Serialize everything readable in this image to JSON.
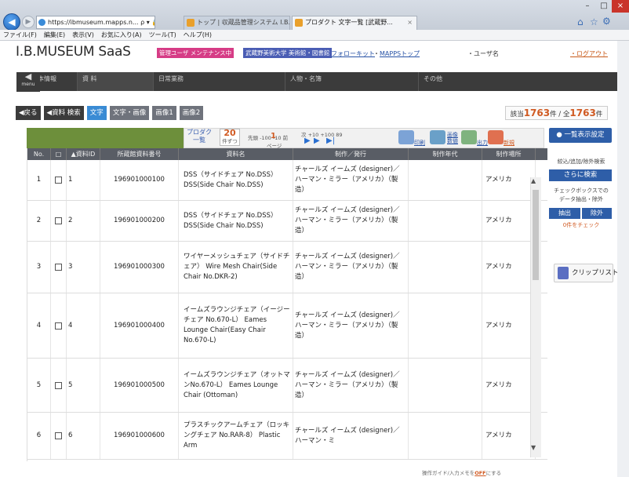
{
  "browser": {
    "address": "https://ibmuseum.mapps.n...",
    "address_icons": "ρ ▾ 🔒 C",
    "tabs": [
      {
        "label": "トップ | 収蔵品管理システム I.B...."
      },
      {
        "label": "プロダクト 文字一覧 [武蔵野...",
        "close": "×"
      }
    ],
    "window_controls": {
      "minimize": "–",
      "maximize": "□",
      "close": "×"
    },
    "toolbar_icons": {
      "home": "⌂",
      "favorites": "☆",
      "settings": "⚙"
    }
  },
  "menubar": [
    "ファイル(F)",
    "編集(E)",
    "表示(V)",
    "お気に入り(A)",
    "ツール(T)",
    "ヘルプ(H)"
  ],
  "header": {
    "logo": "I.B.MUSEUM SaaS",
    "admin_badge": "管理ユーザ メンテナンス中",
    "univ_badge": "武蔵野美術大学 美術館・図書館",
    "follow_link": "フォローキット",
    "mapps_link": "MAPPSトップ",
    "separator": "・",
    "username": "・ユーザ名",
    "logout": "・ログアウト"
  },
  "nav": {
    "menu": "menu",
    "items": [
      "基本情報",
      "資 料",
      "日常業務",
      "人物・名簿",
      "その他"
    ]
  },
  "subtabs": {
    "back": "◀戻る",
    "search": "◀資料 検索",
    "text": "文字",
    "text_image": "文字・画像",
    "image1": "画像1",
    "image2": "画像2"
  },
  "count": {
    "prefix": "該当",
    "hits": "1763",
    "mid": "件 / 全",
    "total": "1763",
    "suffix": "件"
  },
  "pager": {
    "product_list": "プロダク\n一覧",
    "per_page": "20",
    "per_page_unit": "件ずつ",
    "prev": "先頭 -100 -10 前",
    "current_page": "1",
    "page_unit": "ページ",
    "next": "次 +10 +100 89",
    "tools": {
      "print": "印刷",
      "stats": "画像\n数値",
      "output": "出力",
      "new": "新規"
    }
  },
  "display_settings": "一覧表示設定",
  "table": {
    "headers": [
      "No.",
      "□",
      "▲資料ID",
      "所蔵館資料番号",
      "資料名",
      "制作／発行",
      "制作年代",
      "制作場所"
    ],
    "rows": [
      {
        "no": "1",
        "id": "1",
        "num": "196901000100",
        "name": "DSS（サイドチェア No.DSS） DSS(Side Chair No.DSS)",
        "maker": "チャールズ イームズ (designer)／ハーマン・ミラー（アメリカ）（製造）",
        "year": "",
        "place": "アメリカ"
      },
      {
        "no": "2",
        "id": "2",
        "num": "196901000200",
        "name": "DSS（サイドチェア No.DSS） DSS(Side Chair No.DSS)",
        "maker": "チャールズ イームズ (designer)／ハーマン・ミラー（アメリカ）（製造）",
        "year": "",
        "place": "アメリカ"
      },
      {
        "no": "3",
        "id": "3",
        "num": "196901000300",
        "name": "ワイヤーメッシュチェア（サイドチェア） Wire Mesh Chair(Side Chair No.DKR-2)",
        "maker": "チャールズ イームズ (designer)／ハーマン・ミラー（アメリカ）（製造）",
        "year": "",
        "place": "アメリカ"
      },
      {
        "no": "4",
        "id": "4",
        "num": "196901000400",
        "name": "イームズラウンジチェア（イージーチェア No.670-L） Eames Lounge Chair(Easy Chair No.670-L)",
        "maker": "チャールズ イームズ (designer)／ハーマン・ミラー（アメリカ）（製造）",
        "year": "",
        "place": "アメリカ"
      },
      {
        "no": "5",
        "id": "5",
        "num": "196901000500",
        "name": "イームズラウンジチェア（オットマンNo.670-L） Eames Lounge Chair (Ottoman)",
        "maker": "チャールズ イームズ (designer)／ハーマン・ミラー（アメリカ）（製造）",
        "year": "",
        "place": "アメリカ"
      },
      {
        "no": "6",
        "id": "6",
        "num": "196901000600",
        "name": "プラスチックアームチェア（ロッキングチェア No.RAR-8） Plastic Arm",
        "maker": "チャールズ イームズ (designer)／ハーマン・ミ",
        "year": "",
        "place": "アメリカ"
      }
    ]
  },
  "sidebar": {
    "label": "絞込/追加/除外検索",
    "more_search": "さらに検索",
    "note": "チェックボックスでの\nデータ抽出・除外",
    "extract": "抽出",
    "exclude": "除外",
    "checked": "0件をチェック",
    "cliplist": "クリップリスト"
  },
  "footer": {
    "prefix": "操作ガイド/入力メモを",
    "off": "OFF",
    "suffix": "にする"
  },
  "colors": {
    "accent": "#2e5ea8",
    "highlight": "#d05a22",
    "nav": "#3b3b3b",
    "green": "#6d8f3b",
    "badge_pink": "#d63c86"
  }
}
